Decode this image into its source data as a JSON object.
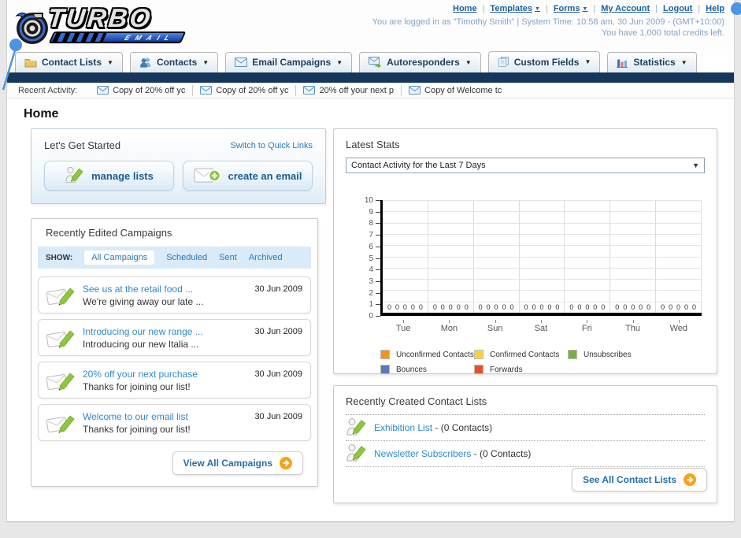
{
  "page": {
    "heading": "Home"
  },
  "header": {
    "logo": {
      "line1": "TURBO",
      "line2": "EMAIL"
    },
    "nav_links": [
      {
        "label": "Home",
        "dropdown": false
      },
      {
        "label": "Templates",
        "dropdown": true
      },
      {
        "label": "Forms",
        "dropdown": true
      },
      {
        "label": "My Account",
        "dropdown": false
      },
      {
        "label": "Logout",
        "dropdown": false
      },
      {
        "label": "Help",
        "dropdown": false
      }
    ],
    "login_info": "You are logged in as \"Timothy Smith\" | System Time: 10:58 am, 30 Jun 2009 - (GMT+10:00)",
    "credits_info": "You have 1,000 total credits left."
  },
  "tabs": [
    {
      "label": "Contact Lists"
    },
    {
      "label": "Contacts"
    },
    {
      "label": "Email Campaigns"
    },
    {
      "label": "Autoresponders"
    },
    {
      "label": "Custom Fields"
    },
    {
      "label": "Statistics"
    }
  ],
  "recent_activity": {
    "label": "Recent Activity:",
    "items": [
      "Copy of 20% off yc",
      "Copy of 20% off yc",
      "20% off your next p",
      "Copy of Welcome tc"
    ]
  },
  "get_started": {
    "title": "Let's Get Started",
    "switch_link": "Switch to Quick Links",
    "manage_lists_label": "manage lists",
    "create_email_label": "create an email"
  },
  "campaigns": {
    "title": "Recently Edited Campaigns",
    "show_label": "SHOW:",
    "filters": [
      {
        "label": "All Campaigns",
        "selected": true
      },
      {
        "label": "Scheduled",
        "selected": false
      },
      {
        "label": "Sent",
        "selected": false
      },
      {
        "label": "Archived",
        "selected": false
      }
    ],
    "items": [
      {
        "title": "See us at the retail food ...",
        "subtitle": "We're giving away our late ...",
        "date": "30 Jun 2009"
      },
      {
        "title": "Introducing our new range ...",
        "subtitle": "Introducing our new Italia ...",
        "date": "30 Jun 2009"
      },
      {
        "title": "20% off your next purchase",
        "subtitle": "Thanks for joining our list!",
        "date": "30 Jun 2009"
      },
      {
        "title": "Welcome to our email list",
        "subtitle": "Thanks for joining our list!",
        "date": "30 Jun 2009"
      }
    ],
    "view_all_label": "View All Campaigns"
  },
  "stats": {
    "title": "Latest Stats",
    "selected_option": "Contact Activity for the Last 7 Days"
  },
  "chart_data": {
    "type": "bar",
    "title": "Contact Activity for the Last 7 Days",
    "categories": [
      "Tue",
      "Mon",
      "Sun",
      "Sat",
      "Fri",
      "Thu",
      "Wed"
    ],
    "series": [
      {
        "name": "Unconfirmed Contacts",
        "color": "#f6921e",
        "values": [
          0,
          0,
          0,
          0,
          0,
          0,
          0
        ]
      },
      {
        "name": "Confirmed Contacts",
        "color": "#fcd13e",
        "values": [
          0,
          0,
          0,
          0,
          0,
          0,
          0
        ]
      },
      {
        "name": "Unsubscribes",
        "color": "#76b043",
        "values": [
          0,
          0,
          0,
          0,
          0,
          0,
          0
        ]
      },
      {
        "name": "Bounces",
        "color": "#5b79b5",
        "values": [
          0,
          0,
          0,
          0,
          0,
          0,
          0
        ]
      },
      {
        "name": "Forwards",
        "color": "#e8502d",
        "values": [
          0,
          0,
          0,
          0,
          0,
          0,
          0
        ]
      }
    ],
    "xlabel": "",
    "ylabel": "",
    "ylim": [
      0,
      10
    ],
    "ytick_step": 1,
    "grid": true,
    "legend_position": "bottom"
  },
  "contact_lists": {
    "title": "Recently Created Contact Lists",
    "items": [
      {
        "name": "Exhibition List",
        "detail": " - (0 Contacts)"
      },
      {
        "name": "Newsletter Subscribers",
        "detail": " - (0 Contacts)"
      }
    ],
    "see_all_label": "See All Contact Lists"
  }
}
